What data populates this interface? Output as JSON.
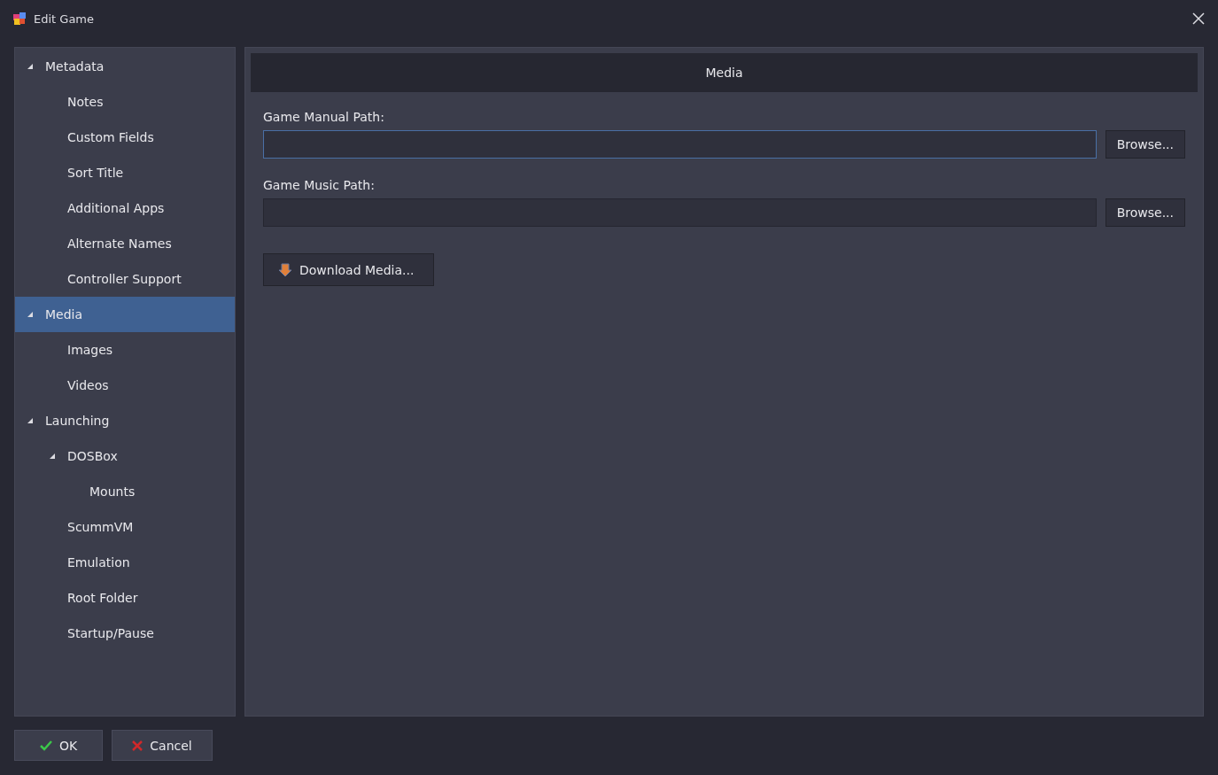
{
  "window": {
    "title": "Edit Game"
  },
  "tree": [
    {
      "label": "Metadata",
      "expanded": true,
      "selected": false,
      "children": [
        {
          "label": "Notes",
          "selected": false
        },
        {
          "label": "Custom Fields",
          "selected": false
        },
        {
          "label": "Sort Title",
          "selected": false
        },
        {
          "label": "Additional Apps",
          "selected": false
        },
        {
          "label": "Alternate Names",
          "selected": false
        },
        {
          "label": "Controller Support",
          "selected": false
        }
      ]
    },
    {
      "label": "Media",
      "expanded": true,
      "selected": true,
      "children": [
        {
          "label": "Images",
          "selected": false
        },
        {
          "label": "Videos",
          "selected": false
        }
      ]
    },
    {
      "label": "Launching",
      "expanded": true,
      "selected": false,
      "children": [
        {
          "label": "DOSBox",
          "expanded": true,
          "selected": false,
          "children": [
            {
              "label": "Mounts",
              "selected": false
            }
          ]
        },
        {
          "label": "ScummVM",
          "selected": false
        },
        {
          "label": "Emulation",
          "selected": false
        },
        {
          "label": "Root Folder",
          "selected": false
        },
        {
          "label": "Startup/Pause",
          "selected": false
        }
      ]
    }
  ],
  "panel": {
    "title": "Media",
    "fields": [
      {
        "label": "Game Manual Path:",
        "focused": true,
        "button": "Browse..."
      },
      {
        "label": "Game Music Path:",
        "focused": false,
        "button": "Browse..."
      }
    ],
    "download_button": "Download Media..."
  },
  "footer": {
    "ok": "OK",
    "cancel": "Cancel"
  }
}
